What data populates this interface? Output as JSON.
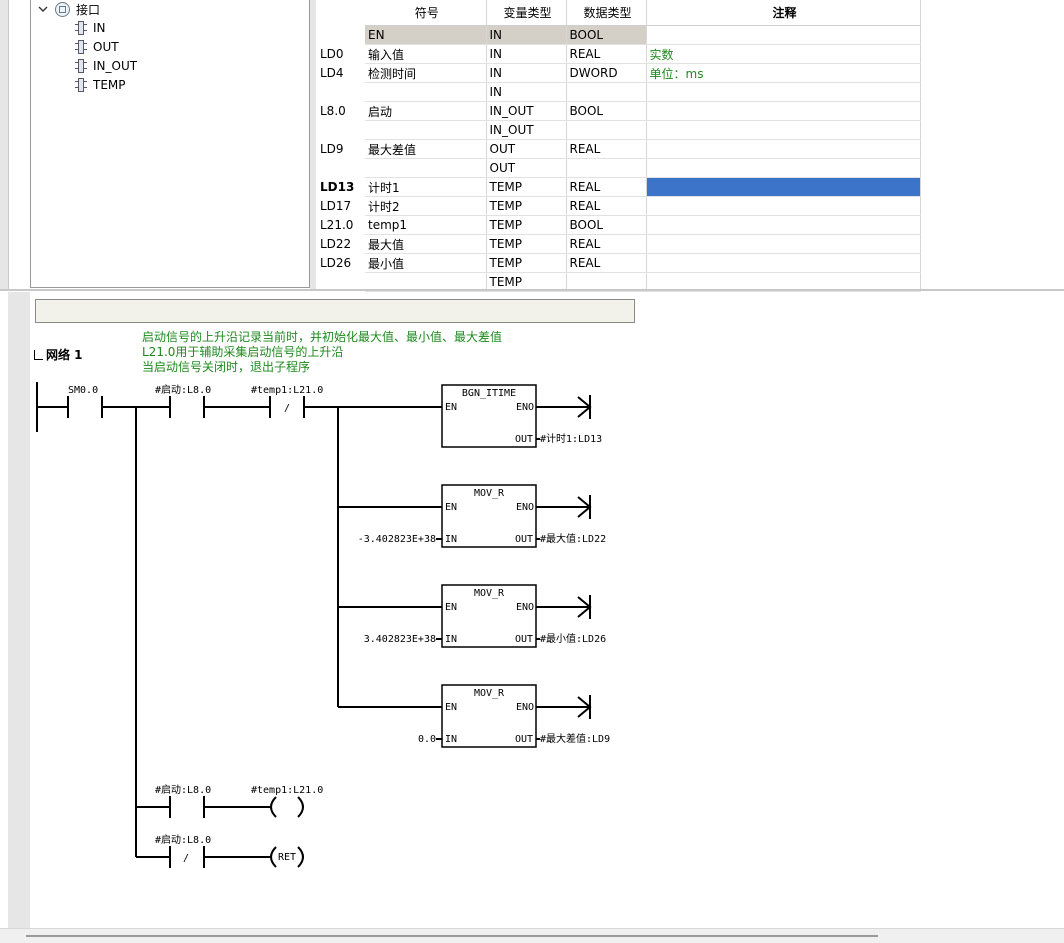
{
  "tree": {
    "root_label": "接口",
    "items": [
      "IN",
      "OUT",
      "IN_OUT",
      "TEMP"
    ]
  },
  "table": {
    "headers": [
      "符号",
      "变量类型",
      "数据类型",
      "注释"
    ],
    "rows": [
      {
        "addr": "",
        "symbol": "EN",
        "var_type": "IN",
        "data_type": "BOOL",
        "comment": ""
      },
      {
        "addr": "LD0",
        "symbol": "输入值",
        "var_type": "IN",
        "data_type": "REAL",
        "comment": "实数"
      },
      {
        "addr": "LD4",
        "symbol": "检测时间",
        "var_type": "IN",
        "data_type": "DWORD",
        "comment": "单位：ms"
      },
      {
        "addr": "",
        "symbol": "",
        "var_type": "IN",
        "data_type": "",
        "comment": ""
      },
      {
        "addr": "L8.0",
        "symbol": "启动",
        "var_type": "IN_OUT",
        "data_type": "BOOL",
        "comment": ""
      },
      {
        "addr": "",
        "symbol": "",
        "var_type": "IN_OUT",
        "data_type": "",
        "comment": ""
      },
      {
        "addr": "LD9",
        "symbol": "最大差值",
        "var_type": "OUT",
        "data_type": "REAL",
        "comment": ""
      },
      {
        "addr": "",
        "symbol": "",
        "var_type": "OUT",
        "data_type": "",
        "comment": ""
      },
      {
        "addr": "LD13",
        "symbol": "计时1",
        "var_type": "TEMP",
        "data_type": "REAL",
        "comment": ""
      },
      {
        "addr": "LD17",
        "symbol": "计时2",
        "var_type": "TEMP",
        "data_type": "REAL",
        "comment": ""
      },
      {
        "addr": "L21.0",
        "symbol": "temp1",
        "var_type": "TEMP",
        "data_type": "BOOL",
        "comment": ""
      },
      {
        "addr": "LD22",
        "symbol": "最大值",
        "var_type": "TEMP",
        "data_type": "REAL",
        "comment": ""
      },
      {
        "addr": "LD26",
        "symbol": "最小值",
        "var_type": "TEMP",
        "data_type": "REAL",
        "comment": ""
      },
      {
        "addr": "",
        "symbol": "",
        "var_type": "TEMP",
        "data_type": "",
        "comment": ""
      }
    ],
    "selected_row": 8
  },
  "network": {
    "label": "网络 1",
    "comments": [
      "启动信号的上升沿记录当前时，并初始化最大值、最小值、最大差值",
      "L21.0用于辅助采集启动信号的上升沿",
      "当启动信号关闭时，退出子程序"
    ],
    "contacts": {
      "sm": "SM0.0",
      "start": "#启动:L8.0",
      "temp1": "#temp1:L21.0",
      "not_symbol": "/"
    },
    "boxes": [
      {
        "name": "BGN_ITIME",
        "in_value": "",
        "out_value": "#计时1:LD13"
      },
      {
        "name": "MOV_R",
        "in_value": "-3.402823E+38",
        "out_value": "#最大值:LD22"
      },
      {
        "name": "MOV_R",
        "in_value": "3.402823E+38",
        "out_value": "#最小值:LD26"
      },
      {
        "name": "MOV_R",
        "in_value": "0.0",
        "out_value": "#最大差值:LD9"
      }
    ],
    "pin_labels": {
      "en": "EN",
      "eno": "ENO",
      "in": "IN",
      "out": "OUT"
    },
    "coil_label": "#temp1:L21.0",
    "branch2_contact": "#启动:L8.0",
    "branch3_contact": "#启动:L8.0",
    "ret_label": "RET"
  }
}
